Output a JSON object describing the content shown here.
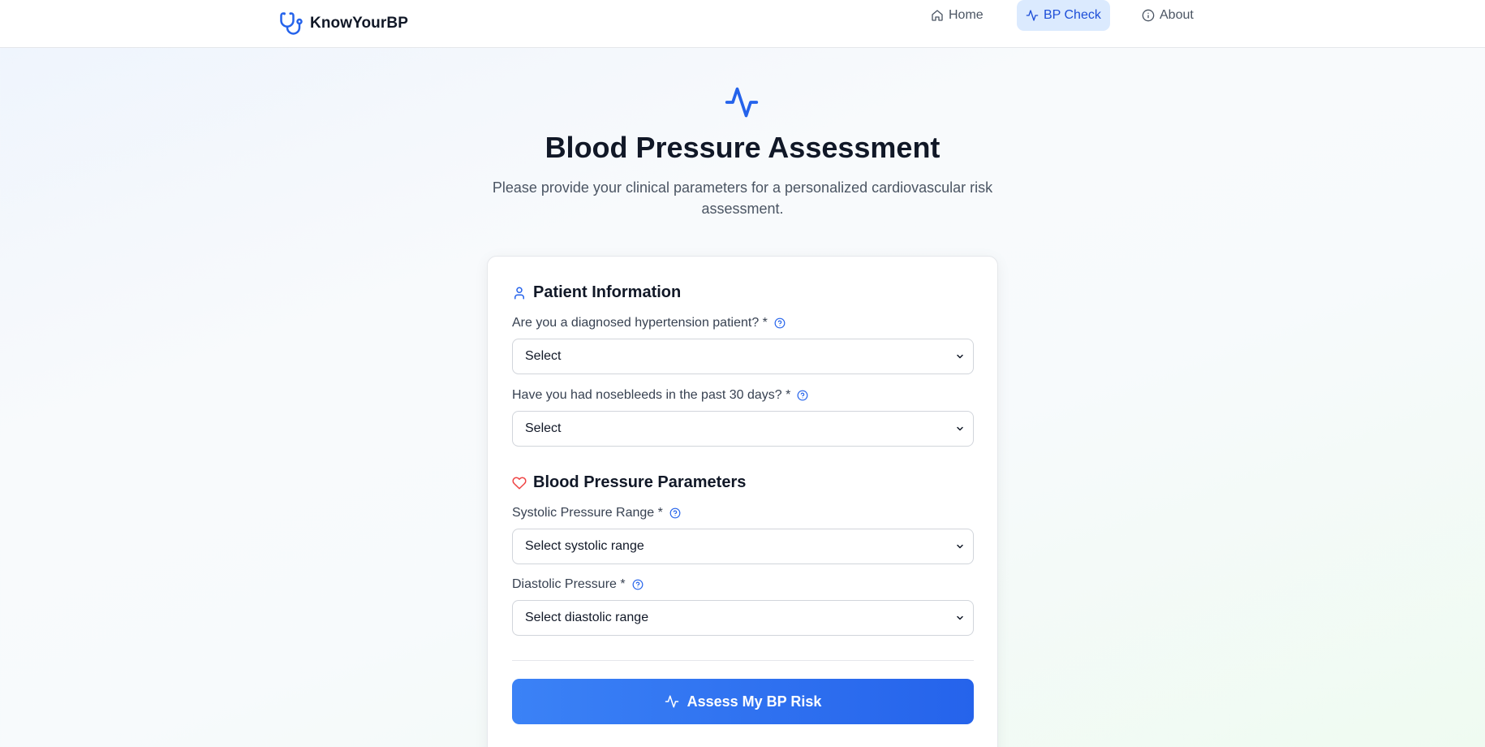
{
  "brand": {
    "name": "KnowYourBP",
    "icon": "stethoscope-icon"
  },
  "nav": {
    "items": [
      {
        "label": "Home",
        "icon": "home-icon",
        "active": false
      },
      {
        "label": "BP Check",
        "icon": "activity-icon",
        "active": true
      },
      {
        "label": "About",
        "icon": "info-icon",
        "active": false
      }
    ]
  },
  "hero": {
    "icon": "activity-icon",
    "title": "Blood Pressure Assessment",
    "subtitle": "Please provide your clinical parameters for a personalized cardiovascular risk assessment."
  },
  "form": {
    "patient_section": {
      "title": "Patient Information",
      "icon": "user-icon",
      "fields": [
        {
          "label": "Are you a diagnosed hypertension patient? *",
          "value": "Select"
        },
        {
          "label": "Have you had nosebleeds in the past 30 days? *",
          "value": "Select"
        }
      ]
    },
    "bp_section": {
      "title": "Blood Pressure Parameters",
      "icon": "heart-icon",
      "fields": [
        {
          "label": "Systolic Pressure Range *",
          "value": "Select systolic range"
        },
        {
          "label": "Diastolic Pressure *",
          "value": "Select diastolic range"
        }
      ]
    },
    "submit_label": "Assess My BP Risk"
  },
  "colors": {
    "accent": "#2563eb",
    "accent_light": "#dbeafe",
    "heart": "#ef4444",
    "text": "#111827",
    "muted": "#4b5563"
  }
}
